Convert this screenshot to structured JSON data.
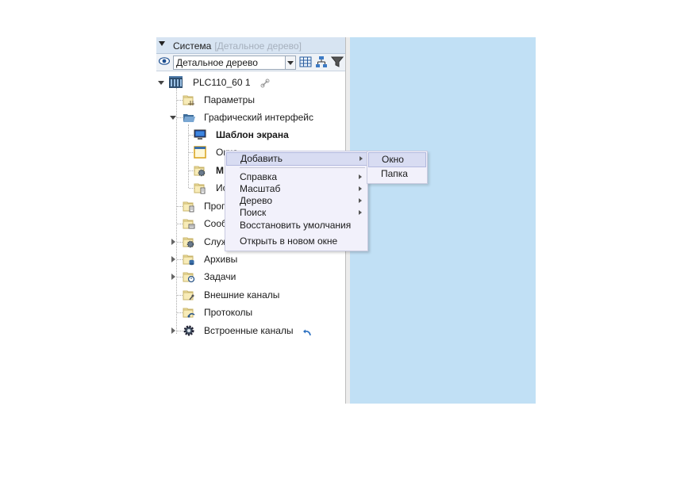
{
  "panel": {
    "title": "Система",
    "title_hint": "[Детальное дерево]",
    "view_select": "Детальное дерево"
  },
  "tree": [
    {
      "label": "PLC110_60 1",
      "icon": "device-icon",
      "expander": "down"
    },
    {
      "label": "Параметры",
      "icon": "folder-params-icon",
      "expander": "none"
    },
    {
      "label": "Графический интерфейс",
      "icon": "folder-open-icon",
      "expander": "down"
    },
    {
      "label": "Шаблон экрана",
      "icon": "monitor-icon",
      "expander": "none",
      "bold": true
    },
    {
      "label": "Окна",
      "icon": "window-icon",
      "expander": "none"
    },
    {
      "label": "М",
      "icon": "folder-gear-icon",
      "expander": "none",
      "bold": true
    },
    {
      "label": "Ис",
      "icon": "folder-doc-icon",
      "expander": "none"
    },
    {
      "label": "Прог",
      "icon": "folder-doc-icon",
      "expander": "none"
    },
    {
      "label": "Сооб",
      "icon": "folder-msg-icon",
      "expander": "none"
    },
    {
      "label": "Служ",
      "icon": "folder-gear-icon",
      "expander": "right"
    },
    {
      "label": "Архивы",
      "icon": "folder-db-icon",
      "expander": "right"
    },
    {
      "label": "Задачи",
      "icon": "folder-task-icon",
      "expander": "right"
    },
    {
      "label": "Внешние каналы",
      "icon": "folder-link-icon",
      "expander": "none"
    },
    {
      "label": "Протоколы",
      "icon": "folder-proto-icon",
      "expander": "none"
    },
    {
      "label": "Встроенные каналы",
      "icon": "gear-icon",
      "expander": "right"
    }
  ],
  "context_menu": {
    "items": [
      {
        "label": "Добавить",
        "submenu": true,
        "highlighted": true
      },
      {
        "label": "Справка",
        "submenu": true
      },
      {
        "label": "Масштаб",
        "submenu": true
      },
      {
        "label": "Дерево",
        "submenu": true
      },
      {
        "label": "Поиск",
        "submenu": true
      },
      {
        "label": "Восстановить умолчания",
        "submenu": false
      },
      {
        "label": "Открыть в новом окне",
        "submenu": false
      }
    ]
  },
  "submenu": {
    "items": [
      {
        "label": "Окно",
        "highlighted": true
      },
      {
        "label": "Папка",
        "highlighted": false
      }
    ]
  },
  "colors": {
    "right_panel": "#c1e0f5",
    "menu_bg": "#f2f1fb",
    "menu_highlight": "#d8dcf2"
  }
}
